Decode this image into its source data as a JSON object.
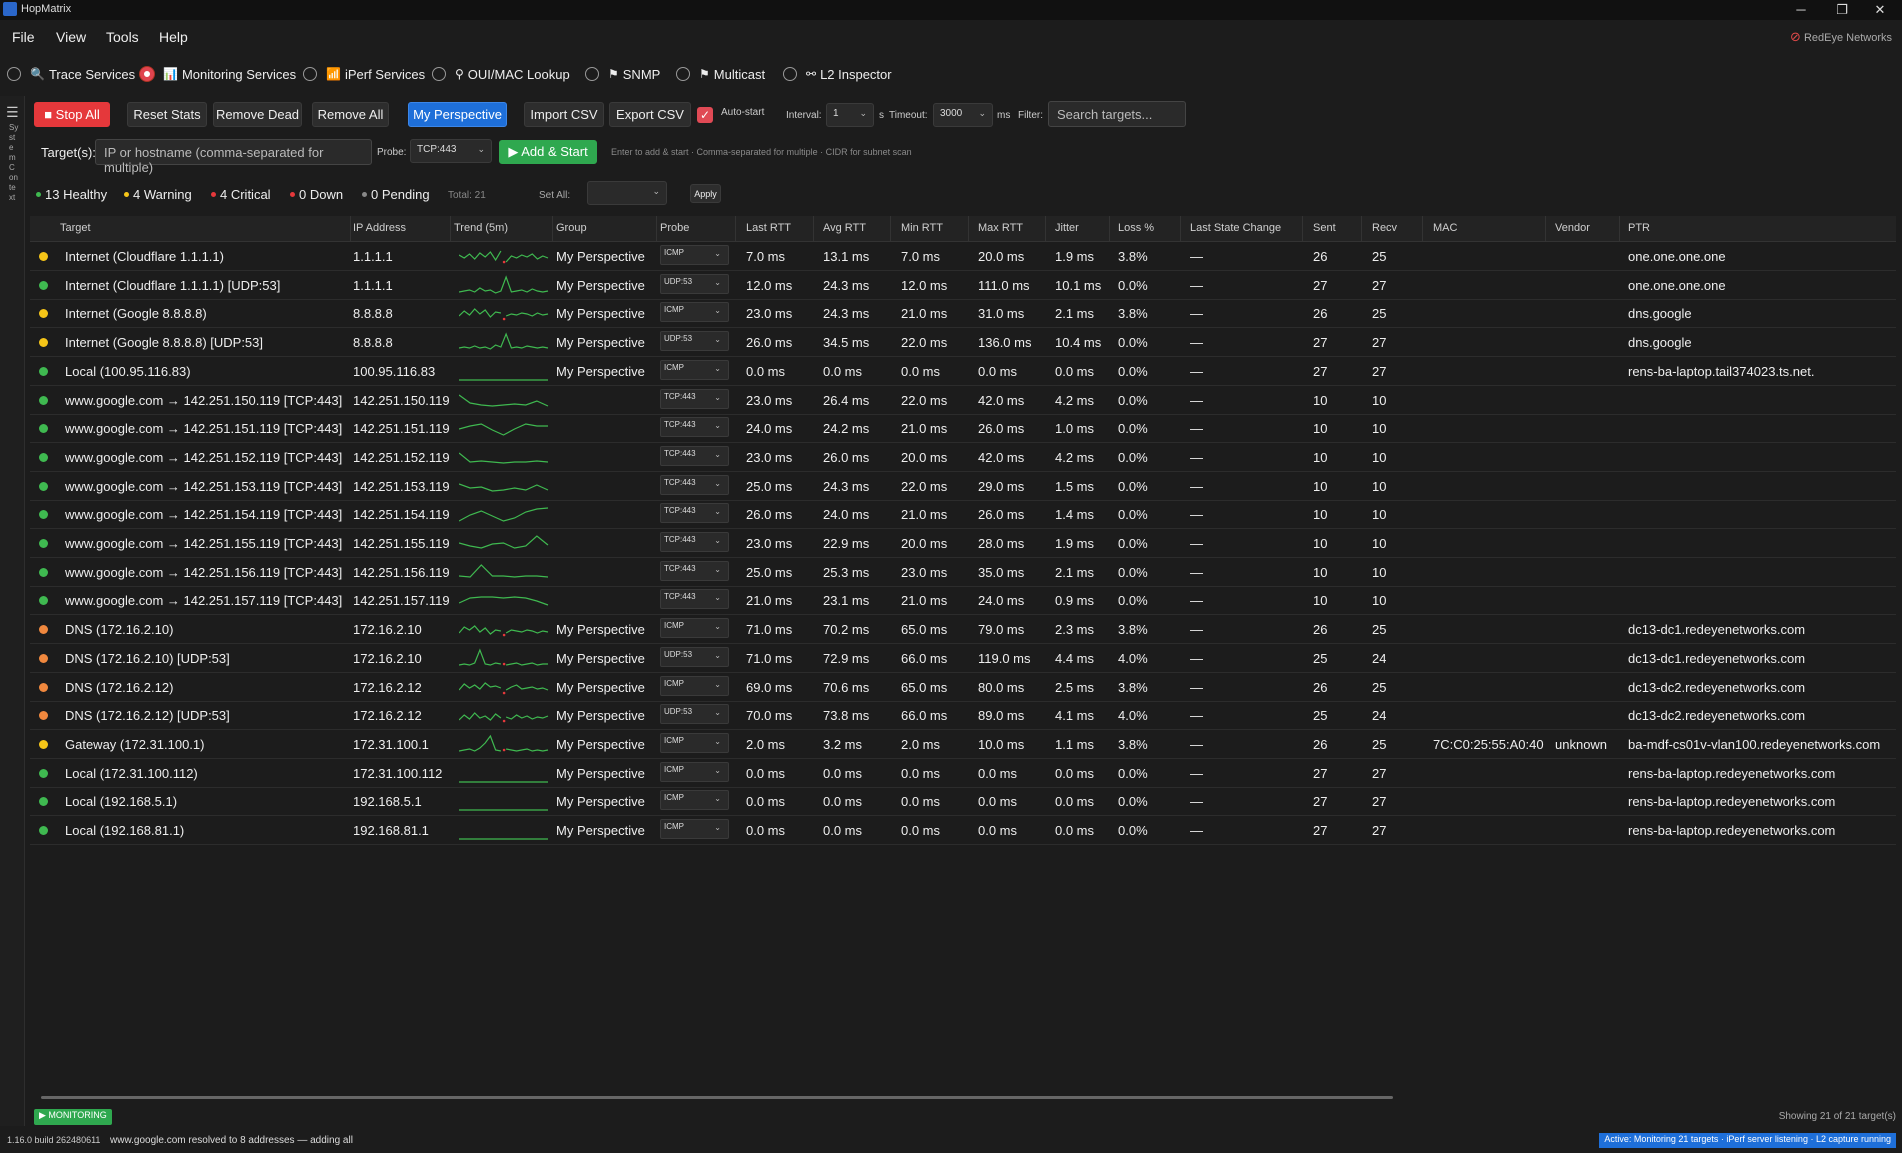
{
  "window": {
    "title": "HopMatrix",
    "controls": [
      "─",
      "❐",
      "✕"
    ]
  },
  "menu": {
    "items": [
      "File",
      "View",
      "Tools",
      "Help"
    ]
  },
  "brand": "RedEye Networks",
  "services": [
    {
      "label": "Trace Services",
      "icon": "🔍",
      "selected": false
    },
    {
      "label": "Monitoring Services",
      "icon": "📊",
      "selected": true
    },
    {
      "label": "iPerf Services",
      "icon": "📶",
      "selected": false
    },
    {
      "label": "OUI/MAC Lookup",
      "icon": "⚲",
      "selected": false
    },
    {
      "label": "SNMP",
      "icon": "⚑",
      "selected": false
    },
    {
      "label": "Multicast",
      "icon": "⚑",
      "selected": false
    },
    {
      "label": "L2 Inspector",
      "icon": "⚯",
      "selected": false
    }
  ],
  "rail": {
    "menu_icon": "☰",
    "label": "System Context"
  },
  "toolbar": {
    "stop_all": "■ Stop All",
    "reset_stats": "Reset Stats",
    "remove_dead": "Remove Dead",
    "remove_all": "Remove All",
    "my_perspective": "My Perspective",
    "import_csv": "Import CSV",
    "export_csv": "Export CSV",
    "auto_start_label": "Auto-start",
    "auto_start_checked": "✓",
    "interval_label": "Interval:",
    "interval_value": "1",
    "interval_unit": "s",
    "timeout_label": "Timeout:",
    "timeout_value": "3000",
    "timeout_unit": "ms",
    "filter_label": "Filter:",
    "filter_placeholder": "Search targets..."
  },
  "target_bar": {
    "label": "Target(s):",
    "placeholder": "IP or hostname (comma-separated for multiple)",
    "probe_label": "Probe:",
    "probe_value": "TCP:443",
    "add_start": "▶ Add & Start",
    "hint": "Enter to add & start · Comma-separated for multiple · CIDR for subnet scan"
  },
  "summary": {
    "healthy": "13 Healthy",
    "warning": "4 Warning",
    "critical": "4 Critical",
    "down": "0 Down",
    "pending": "0 Pending",
    "total": "Total: 21",
    "set_all_label": "Set All:",
    "apply": "Apply"
  },
  "colors": {
    "healthy": "#3fb950",
    "warning": "#f5c518",
    "critical": "#f0883e",
    "down": "#e5383b",
    "pending": "#888888",
    "spark": "#3fb950"
  },
  "columns": [
    "Target",
    "IP Address",
    "Trend (5m)",
    "Group",
    "Probe",
    "Last RTT",
    "Avg RTT",
    "Min RTT",
    "Max RTT",
    "Jitter",
    "Loss %",
    "Last State Change",
    "Sent",
    "Recv",
    "MAC",
    "Vendor",
    "PTR"
  ],
  "rows": [
    {
      "status": "warning",
      "target": "Internet (Cloudflare 1.1.1.1)",
      "ip": "1.1.1.1",
      "group": "My Perspective",
      "probe": "ICMP",
      "last": "7.0 ms",
      "avg": "13.1 ms",
      "min": "7.0 ms",
      "max": "20.0 ms",
      "jitter": "1.9 ms",
      "loss": "3.8%",
      "change": "—",
      "sent": "26",
      "recv": "25",
      "mac": "",
      "vendor": "",
      "ptr": "one.one.one.one",
      "trend": [
        10,
        13,
        9,
        14,
        8,
        12,
        7,
        15,
        6,
        17,
        11,
        13,
        10,
        12,
        9,
        14,
        11,
        13
      ],
      "gap": 9
    },
    {
      "status": "healthy",
      "target": "Internet (Cloudflare 1.1.1.1) [UDP:53]",
      "ip": "1.1.1.1",
      "group": "My Perspective",
      "probe": "UDP:53",
      "last": "12.0 ms",
      "avg": "24.3 ms",
      "min": "12.0 ms",
      "max": "111.0 ms",
      "jitter": "10.1 ms",
      "loss": "0.0%",
      "change": "—",
      "sent": "27",
      "recv": "27",
      "mac": "",
      "vendor": "",
      "ptr": "one.one.one.one",
      "trend": [
        18,
        17,
        16,
        18,
        14,
        17,
        16,
        19,
        17,
        3,
        18,
        17,
        16,
        18,
        15,
        17,
        18,
        17
      ],
      "gap": -1
    },
    {
      "status": "warning",
      "target": "Internet (Google 8.8.8.8)",
      "ip": "8.8.8.8",
      "group": "My Perspective",
      "probe": "ICMP",
      "last": "23.0 ms",
      "avg": "24.3 ms",
      "min": "21.0 ms",
      "max": "31.0 ms",
      "jitter": "2.1 ms",
      "loss": "3.8%",
      "change": "—",
      "sent": "26",
      "recv": "25",
      "mac": "",
      "vendor": "",
      "ptr": "dns.google",
      "trend": [
        14,
        9,
        13,
        7,
        12,
        8,
        15,
        10,
        11,
        14,
        12,
        13,
        11,
        12,
        14,
        11,
        13,
        12
      ],
      "gap": 9
    },
    {
      "status": "warning",
      "target": "Internet (Google 8.8.8.8) [UDP:53]",
      "ip": "8.8.8.8",
      "group": "My Perspective",
      "probe": "UDP:53",
      "last": "26.0 ms",
      "avg": "34.5 ms",
      "min": "22.0 ms",
      "max": "136.0 ms",
      "jitter": "10.4 ms",
      "loss": "0.0%",
      "change": "—",
      "sent": "27",
      "recv": "27",
      "mac": "",
      "vendor": "",
      "ptr": "dns.google",
      "trend": [
        17,
        16,
        17,
        15,
        17,
        16,
        18,
        14,
        16,
        3,
        17,
        16,
        17,
        15,
        16,
        17,
        16,
        17
      ],
      "gap": -1
    },
    {
      "status": "healthy",
      "target": "Local (100.95.116.83)",
      "ip": "100.95.116.83",
      "group": "My Perspective",
      "probe": "ICMP",
      "last": "0.0 ms",
      "avg": "0.0 ms",
      "min": "0.0 ms",
      "max": "0.0 ms",
      "jitter": "0.0 ms",
      "loss": "0.0%",
      "change": "—",
      "sent": "27",
      "recv": "27",
      "mac": "",
      "vendor": "",
      "ptr": "rens-ba-laptop.tail374023.ts.net.",
      "trend": [
        20,
        20,
        20,
        20,
        20,
        20,
        20,
        20,
        20,
        20,
        20,
        20,
        20,
        20,
        20,
        20,
        20,
        20
      ],
      "gap": -1
    },
    {
      "status": "healthy",
      "target": "www.google.com → 142.251.150.119 [TCP:443]",
      "ip": "142.251.150.119",
      "group": "",
      "probe": "TCP:443",
      "last": "23.0 ms",
      "avg": "26.4 ms",
      "min": "22.0 ms",
      "max": "42.0 ms",
      "jitter": "4.2 ms",
      "loss": "0.0%",
      "change": "—",
      "sent": "10",
      "recv": "10",
      "mac": "",
      "vendor": "",
      "ptr": "",
      "trend": [
        6,
        14,
        16,
        17,
        16,
        15,
        16,
        12,
        17
      ],
      "gap": -1
    },
    {
      "status": "healthy",
      "target": "www.google.com → 142.251.151.119 [TCP:443]",
      "ip": "142.251.151.119",
      "group": "",
      "probe": "TCP:443",
      "last": "24.0 ms",
      "avg": "24.2 ms",
      "min": "21.0 ms",
      "max": "26.0 ms",
      "jitter": "1.0 ms",
      "loss": "0.0%",
      "change": "—",
      "sent": "10",
      "recv": "10",
      "mac": "",
      "vendor": "",
      "ptr": "",
      "trend": [
        12,
        9,
        7,
        13,
        18,
        12,
        7,
        9,
        9
      ],
      "gap": -1
    },
    {
      "status": "healthy",
      "target": "www.google.com → 142.251.152.119 [TCP:443]",
      "ip": "142.251.152.119",
      "group": "",
      "probe": "TCP:443",
      "last": "23.0 ms",
      "avg": "26.0 ms",
      "min": "20.0 ms",
      "max": "42.0 ms",
      "jitter": "4.2 ms",
      "loss": "0.0%",
      "change": "—",
      "sent": "10",
      "recv": "10",
      "mac": "",
      "vendor": "",
      "ptr": "",
      "trend": [
        7,
        16,
        15,
        16,
        17,
        16,
        16,
        15,
        16
      ],
      "gap": -1
    },
    {
      "status": "healthy",
      "target": "www.google.com → 142.251.153.119 [TCP:443]",
      "ip": "142.251.153.119",
      "group": "",
      "probe": "TCP:443",
      "last": "25.0 ms",
      "avg": "24.3 ms",
      "min": "22.0 ms",
      "max": "29.0 ms",
      "jitter": "1.5 ms",
      "loss": "0.0%",
      "change": "—",
      "sent": "10",
      "recv": "10",
      "mac": "",
      "vendor": "",
      "ptr": "",
      "trend": [
        9,
        13,
        12,
        16,
        15,
        13,
        15,
        10,
        15
      ],
      "gap": -1
    },
    {
      "status": "healthy",
      "target": "www.google.com → 142.251.154.119 [TCP:443]",
      "ip": "142.251.154.119",
      "group": "",
      "probe": "TCP:443",
      "last": "26.0 ms",
      "avg": "24.0 ms",
      "min": "21.0 ms",
      "max": "26.0 ms",
      "jitter": "1.4 ms",
      "loss": "0.0%",
      "change": "—",
      "sent": "10",
      "recv": "10",
      "mac": "",
      "vendor": "",
      "ptr": "",
      "trend": [
        18,
        12,
        8,
        13,
        18,
        15,
        9,
        6,
        5
      ],
      "gap": -1
    },
    {
      "status": "healthy",
      "target": "www.google.com → 142.251.155.119 [TCP:443]",
      "ip": "142.251.155.119",
      "group": "",
      "probe": "TCP:443",
      "last": "23.0 ms",
      "avg": "22.9 ms",
      "min": "20.0 ms",
      "max": "28.0 ms",
      "jitter": "1.9 ms",
      "loss": "0.0%",
      "change": "—",
      "sent": "10",
      "recv": "10",
      "mac": "",
      "vendor": "",
      "ptr": "",
      "trend": [
        11,
        14,
        16,
        12,
        11,
        16,
        14,
        4,
        13
      ],
      "gap": -1
    },
    {
      "status": "healthy",
      "target": "www.google.com → 142.251.156.119 [TCP:443]",
      "ip": "142.251.156.119",
      "group": "",
      "probe": "TCP:443",
      "last": "25.0 ms",
      "avg": "25.3 ms",
      "min": "23.0 ms",
      "max": "35.0 ms",
      "jitter": "2.1 ms",
      "loss": "0.0%",
      "change": "—",
      "sent": "10",
      "recv": "10",
      "mac": "",
      "vendor": "",
      "ptr": "",
      "trend": [
        15,
        16,
        4,
        15,
        15,
        16,
        15,
        15,
        16
      ],
      "gap": -1
    },
    {
      "status": "healthy",
      "target": "www.google.com → 142.251.157.119 [TCP:443]",
      "ip": "142.251.157.119",
      "group": "",
      "probe": "TCP:443",
      "last": "21.0 ms",
      "avg": "23.1 ms",
      "min": "21.0 ms",
      "max": "24.0 ms",
      "jitter": "0.9 ms",
      "loss": "0.0%",
      "change": "—",
      "sent": "10",
      "recv": "10",
      "mac": "",
      "vendor": "",
      "ptr": "",
      "trend": [
        14,
        9,
        8,
        8,
        9,
        8,
        9,
        12,
        16
      ],
      "gap": -1
    },
    {
      "status": "critical",
      "target": "DNS (172.16.2.10)",
      "ip": "172.16.2.10",
      "group": "My Perspective",
      "probe": "ICMP",
      "last": "71.0 ms",
      "avg": "70.2 ms",
      "min": "65.0 ms",
      "max": "79.0 ms",
      "jitter": "2.3 ms",
      "loss": "3.8%",
      "change": "—",
      "sent": "26",
      "recv": "25",
      "mac": "",
      "vendor": "",
      "ptr": "dc13-dc1.redeyenetworks.com",
      "trend": [
        15,
        9,
        12,
        8,
        14,
        10,
        16,
        12,
        13,
        15,
        12,
        13,
        14,
        12,
        13,
        15,
        13,
        14
      ],
      "gap": 9
    },
    {
      "status": "critical",
      "target": "DNS (172.16.2.10) [UDP:53]",
      "ip": "172.16.2.10",
      "group": "My Perspective",
      "probe": "UDP:53",
      "last": "71.0 ms",
      "avg": "72.9 ms",
      "min": "66.0 ms",
      "max": "119.0 ms",
      "jitter": "4.4 ms",
      "loss": "4.0%",
      "change": "—",
      "sent": "25",
      "recv": "24",
      "mac": "",
      "vendor": "",
      "ptr": "dc13-dc1.redeyenetworks.com",
      "trend": [
        18,
        17,
        18,
        16,
        3,
        17,
        18,
        16,
        17,
        18,
        17,
        16,
        18,
        17,
        16,
        18,
        17,
        17
      ],
      "gap": 9
    },
    {
      "status": "critical",
      "target": "DNS (172.16.2.12)",
      "ip": "172.16.2.12",
      "group": "My Perspective",
      "probe": "ICMP",
      "last": "69.0 ms",
      "avg": "70.6 ms",
      "min": "65.0 ms",
      "max": "80.0 ms",
      "jitter": "2.5 ms",
      "loss": "3.8%",
      "change": "—",
      "sent": "26",
      "recv": "25",
      "mac": "",
      "vendor": "",
      "ptr": "dc13-dc2.redeyenetworks.com",
      "trend": [
        14,
        8,
        12,
        9,
        13,
        7,
        11,
        10,
        12,
        14,
        11,
        9,
        13,
        12,
        11,
        13,
        12,
        14
      ],
      "gap": 9
    },
    {
      "status": "critical",
      "target": "DNS (172.16.2.12) [UDP:53]",
      "ip": "172.16.2.12",
      "group": "My Perspective",
      "probe": "UDP:53",
      "last": "70.0 ms",
      "avg": "73.8 ms",
      "min": "66.0 ms",
      "max": "89.0 ms",
      "jitter": "4.1 ms",
      "loss": "4.0%",
      "change": "—",
      "sent": "25",
      "recv": "24",
      "mac": "",
      "vendor": "",
      "ptr": "dc13-dc2.redeyenetworks.com",
      "trend": [
        16,
        11,
        15,
        9,
        14,
        12,
        16,
        10,
        14,
        13,
        15,
        11,
        14,
        12,
        15,
        13,
        14,
        12
      ],
      "gap": 9
    },
    {
      "status": "warning",
      "target": "Gateway (172.31.100.1)",
      "ip": "172.31.100.1",
      "group": "My Perspective",
      "probe": "ICMP",
      "last": "2.0 ms",
      "avg": "3.2 ms",
      "min": "2.0 ms",
      "max": "10.0 ms",
      "jitter": "1.1 ms",
      "loss": "3.8%",
      "change": "—",
      "sent": "26",
      "recv": "25",
      "mac": "7C:C0:25:55:A0:40",
      "vendor": "unknown",
      "ptr": "ba-mdf-cs01v-vlan100.redeyenetworks.com",
      "trend": [
        18,
        17,
        16,
        18,
        15,
        10,
        3,
        17,
        18,
        16,
        17,
        18,
        17,
        16,
        18,
        17,
        18,
        17
      ],
      "gap": 9
    },
    {
      "status": "healthy",
      "target": "Local (172.31.100.112)",
      "ip": "172.31.100.112",
      "group": "My Perspective",
      "probe": "ICMP",
      "last": "0.0 ms",
      "avg": "0.0 ms",
      "min": "0.0 ms",
      "max": "0.0 ms",
      "jitter": "0.0 ms",
      "loss": "0.0%",
      "change": "—",
      "sent": "27",
      "recv": "27",
      "mac": "",
      "vendor": "",
      "ptr": "rens-ba-laptop.redeyenetworks.com",
      "trend": [
        20,
        20,
        20,
        20,
        20,
        20,
        20,
        20,
        20,
        20,
        20,
        20,
        20,
        20,
        20,
        20,
        20,
        20
      ],
      "gap": -1
    },
    {
      "status": "healthy",
      "target": "Local (192.168.5.1)",
      "ip": "192.168.5.1",
      "group": "My Perspective",
      "probe": "ICMP",
      "last": "0.0 ms",
      "avg": "0.0 ms",
      "min": "0.0 ms",
      "max": "0.0 ms",
      "jitter": "0.0 ms",
      "loss": "0.0%",
      "change": "—",
      "sent": "27",
      "recv": "27",
      "mac": "",
      "vendor": "",
      "ptr": "rens-ba-laptop.redeyenetworks.com",
      "trend": [
        20,
        20,
        20,
        20,
        20,
        20,
        20,
        20,
        20,
        20,
        20,
        20,
        20,
        20,
        20,
        20,
        20,
        20
      ],
      "gap": -1
    },
    {
      "status": "healthy",
      "target": "Local (192.168.81.1)",
      "ip": "192.168.81.1",
      "group": "My Perspective",
      "probe": "ICMP",
      "last": "0.0 ms",
      "avg": "0.0 ms",
      "min": "0.0 ms",
      "max": "0.0 ms",
      "jitter": "0.0 ms",
      "loss": "0.0%",
      "change": "—",
      "sent": "27",
      "recv": "27",
      "mac": "",
      "vendor": "",
      "ptr": "rens-ba-laptop.redeyenetworks.com",
      "trend": [
        20,
        20,
        20,
        20,
        20,
        20,
        20,
        20,
        20,
        20,
        20,
        20,
        20,
        20,
        20,
        20,
        20,
        20
      ],
      "gap": -1
    }
  ],
  "footer": {
    "monitoring_badge": "▶ MONITORING",
    "showing": "Showing 21 of 21 target(s)",
    "version": "1.16.0 build 262480611",
    "status_message": "www.google.com resolved to 8 addresses — adding all",
    "active": "Active: Monitoring 21 targets · iPerf server listening · L2 capture running"
  }
}
